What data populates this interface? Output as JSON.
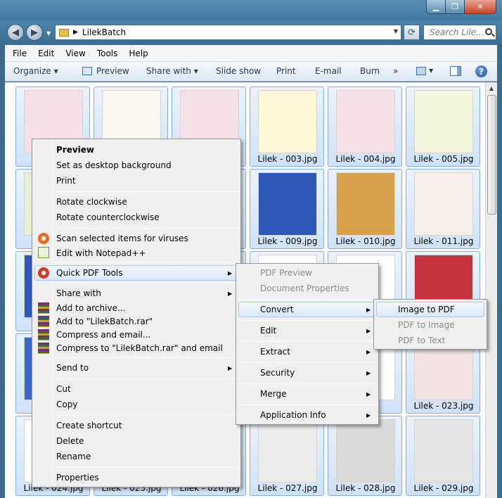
{
  "window": {
    "minimize": "▁",
    "maximize": "❐",
    "close": "✕"
  },
  "address": {
    "path": "LilekBatch",
    "search_placeholder": "Search Lile..."
  },
  "menu": [
    "File",
    "Edit",
    "View",
    "Tools",
    "Help"
  ],
  "toolbar": {
    "organize": "Organize ▾",
    "preview": "Preview",
    "share_with": "Share with ▾",
    "slide_show": "Slide show",
    "print": "Print",
    "email": "E-mail",
    "burn": "Burn",
    "more": "»"
  },
  "files": [
    {
      "label": "Li",
      "thumb": "#f5dfe8"
    },
    {
      "label": "",
      "thumb": "#faf7f0"
    },
    {
      "label": "",
      "thumb": "#f5dfe8"
    },
    {
      "label": "Lilek - 003.jpg",
      "thumb": "#fff6d8"
    },
    {
      "label": "Lilek - 004.jpg",
      "thumb": "#f5dfe8"
    },
    {
      "label": "Lilek - 005.jpg",
      "thumb": "#f3f6dc"
    },
    {
      "label": "Li",
      "thumb": "#e9efd2"
    },
    {
      "label": "",
      "thumb": "#ffffff"
    },
    {
      "label": "",
      "thumb": "#ffffff"
    },
    {
      "label": "Lilek - 009.jpg",
      "thumb": "#2f56b8"
    },
    {
      "label": "Lilek - 010.jpg",
      "thumb": "#d8a04a"
    },
    {
      "label": "Lilek - 011.jpg",
      "thumb": "#f8efe8"
    },
    {
      "label": "Li",
      "thumb": "#2f56b8"
    },
    {
      "label": "",
      "thumb": "#ffffff"
    },
    {
      "label": "",
      "thumb": "#ffffff"
    },
    {
      "label": "",
      "thumb": "#ffffff"
    },
    {
      "label": "",
      "thumb": "#ffffff"
    },
    {
      "label": "",
      "thumb": "#c6323e"
    },
    {
      "label": "Li",
      "thumb": "#3a66c8"
    },
    {
      "label": "",
      "thumb": "#ffffff"
    },
    {
      "label": "",
      "thumb": "#ffffff"
    },
    {
      "label": "",
      "thumb": "#ffffff"
    },
    {
      "label": "",
      "thumb": "#ffffff"
    },
    {
      "label": "Lilek - 023.jpg",
      "thumb": "#f3e3e3"
    },
    {
      "label": "Lilek - 024.jpg",
      "thumb": "#ffffff"
    },
    {
      "label": "Lilek - 025.jpg",
      "thumb": "#ffffff"
    },
    {
      "label": "Lilek - 026.jpg",
      "thumb": "#ffffff"
    },
    {
      "label": "Lilek - 027.jpg",
      "thumb": "#ececec"
    },
    {
      "label": "Lilek - 028.jpg",
      "thumb": "#d9d9d9"
    },
    {
      "label": "Lilek - 029.jpg",
      "thumb": "#e6e6e6"
    }
  ],
  "context_menu": {
    "preview": "Preview",
    "set_desktop": "Set as desktop background",
    "print": "Print",
    "rotate_cw": "Rotate clockwise",
    "rotate_ccw": "Rotate counterclockwise",
    "scan": "Scan selected items for viruses",
    "notepad": "Edit with Notepad++",
    "quick_pdf": "Quick PDF Tools",
    "share_with": "Share with",
    "add_archive": "Add to archive...",
    "add_rar": "Add to \"LilekBatch.rar\"",
    "compress_email": "Compress and email...",
    "compress_rar_email": "Compress to \"LilekBatch.rar\" and email",
    "send_to": "Send to",
    "cut": "Cut",
    "copy": "Copy",
    "create_shortcut": "Create shortcut",
    "delete": "Delete",
    "rename": "Rename",
    "properties": "Properties"
  },
  "quick_pdf_menu": {
    "pdf_preview": "PDF Preview",
    "doc_props": "Document Properties",
    "convert": "Convert",
    "edit": "Edit",
    "extract": "Extract",
    "security": "Security",
    "merge": "Merge",
    "app_info": "Application Info"
  },
  "convert_menu": {
    "image_to_pdf": "Image to PDF",
    "pdf_to_image": "PDF to Image",
    "pdf_to_text": "PDF to Text"
  }
}
